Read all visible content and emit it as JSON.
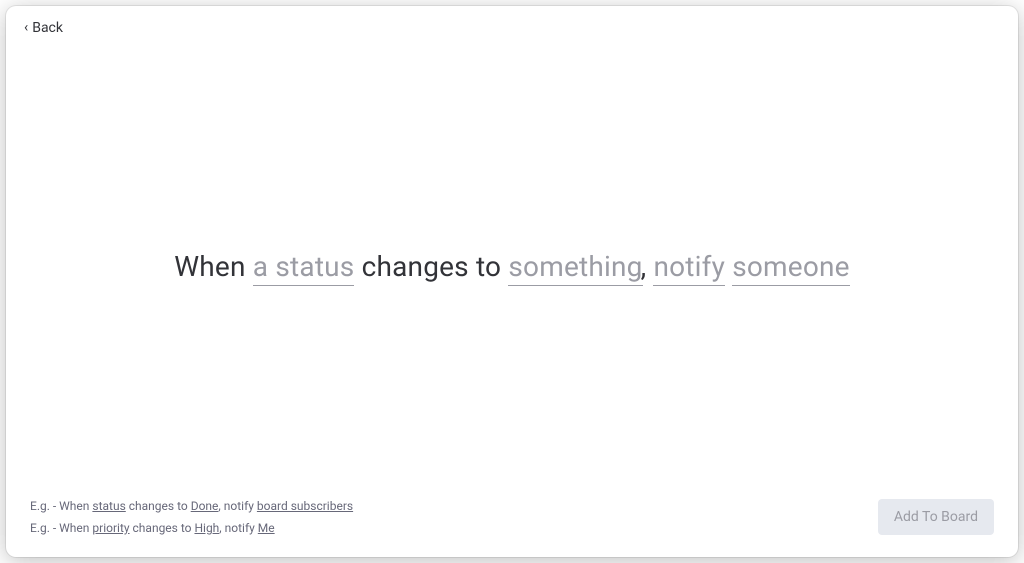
{
  "header": {
    "back_label": "Back"
  },
  "rule": {
    "when_label": "When",
    "status_slot": "a status",
    "changes_to_label": "changes to",
    "value_slot": "something",
    "comma": ",",
    "action_slot": "notify",
    "target_slot": "someone"
  },
  "examples": [
    {
      "prefix": "E.g. - When ",
      "field": "status",
      "mid1": " changes to ",
      "value": "Done",
      "mid2": ", notify ",
      "target": "board subscribers"
    },
    {
      "prefix": "E.g. - When ",
      "field": "priority",
      "mid1": " changes to ",
      "value": "High",
      "mid2": ", notify ",
      "target": "Me"
    }
  ],
  "footer": {
    "add_button_label": "Add To Board"
  }
}
